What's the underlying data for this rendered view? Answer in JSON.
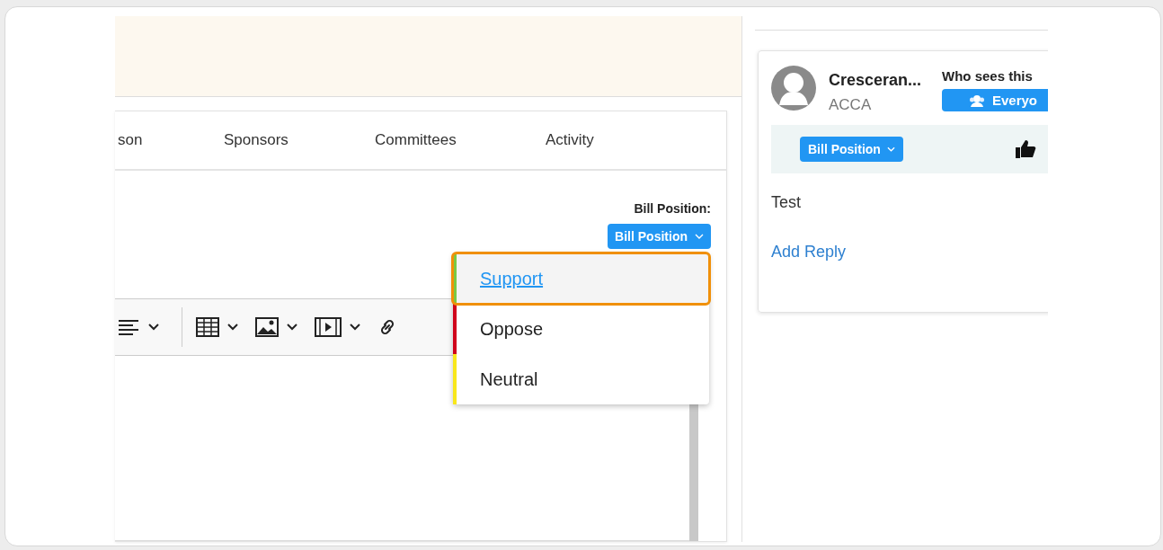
{
  "tabs": [
    {
      "label": "son"
    },
    {
      "label": "Sponsors"
    },
    {
      "label": "Committees"
    },
    {
      "label": "Activity"
    }
  ],
  "bill_position": {
    "label": "Bill Position:",
    "button": "Bill Position"
  },
  "position_menu": [
    {
      "label": "Support",
      "color": "#7ac943",
      "selected": true
    },
    {
      "label": "Oppose",
      "color": "#d0021b",
      "selected": false
    },
    {
      "label": "Neutral",
      "color": "#f8e71c",
      "selected": false
    }
  ],
  "comment": {
    "author": "Cresceran...",
    "organization": "ACCA",
    "visibility_label": "Who sees this",
    "visibility_button": "Everyo",
    "position_button": "Bill Position",
    "body": "Test",
    "reply_link": "Add Reply"
  }
}
